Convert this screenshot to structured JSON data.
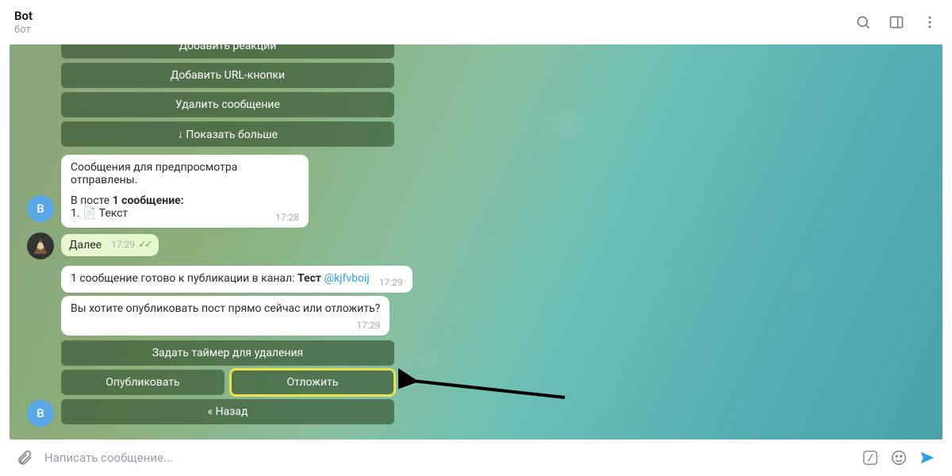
{
  "header": {
    "title": "Bot",
    "subtitle": "бот"
  },
  "buttons": {
    "add_reactions": "Добавить реакции",
    "add_url": "Добавить URL-кнопки",
    "delete_msg": "Удалить сообщение",
    "show_more": "↓ Показать больше",
    "set_timer": "Задать таймер для удаления",
    "publish": "Опубликовать",
    "postpone": "Отложить",
    "back": "« Назад"
  },
  "msg1": {
    "line1": "Сообщения для предпросмотра отправлены.",
    "line2a": "В посте ",
    "line2b": "1 сообщение:",
    "line3": "1. 📄 Текст",
    "time": "17:28"
  },
  "msg_user": {
    "text": "Далее",
    "time": "17:29"
  },
  "msg2": {
    "pre": "1 сообщение готово к публикации в канал: ",
    "bold": "Тест ",
    "link": "@kjfvboij",
    "time": "17:29"
  },
  "msg3": {
    "text": "Вы хотите опубликовать пост прямо сейчас или отложить?",
    "time": "17:29"
  },
  "composer": {
    "placeholder": "Написать сообщение..."
  },
  "avatar": {
    "bot_letter": "В",
    "bot_letter2": "В"
  }
}
